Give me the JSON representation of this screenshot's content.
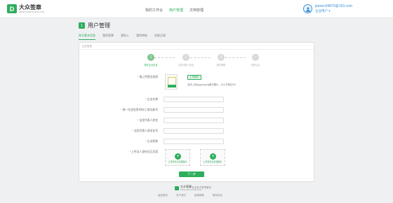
{
  "brand": {
    "name": "大众签章",
    "url": "WWW.DAZHONGQZ.COM",
    "mark": "D"
  },
  "nav": [
    "我的工作台",
    "用户管理",
    "文档管理"
  ],
  "user": {
    "email": "jiamen34870@163.com",
    "role": "企业用户 ▾"
  },
  "page": {
    "title": "用户管理",
    "title_icon": "1"
  },
  "tabs": [
    "账号基本信息",
    "我的签章",
    "我的入",
    "我的审核",
    "消息记录"
  ],
  "breadcrumb": "企业信息",
  "steps": [
    {
      "num": "1",
      "label": "填写企业信息"
    },
    {
      "num": "2",
      "label": "法定代表人信息"
    },
    {
      "num": "3",
      "label": "提交审核"
    },
    {
      "num": "✓",
      "label": "完成认证"
    }
  ],
  "form": {
    "license_label": "请上传营业执照",
    "upload_button": "上传图片",
    "upload_hint": "支持上传jpg.jpeg.png格式图片，大小不超过2M",
    "fields": [
      "企业名称",
      "统一社会信用代码/工商注册号",
      "法定代表人姓名",
      "法定代表人身份证号",
      "企业简称"
    ],
    "id_label": "上传法人身份证正反面",
    "id_front": "上传身份证正面图片",
    "id_back": "上传身份证反面图片",
    "submit": "下一步"
  },
  "footer": {
    "name": "大众签章",
    "url": "WWW.DAZHONGQZ.COM",
    "slogan": "专注电子签章服务",
    "links": [
      "返回首页",
      "关于我们",
      "使用帮助",
      "服务协议"
    ]
  }
}
